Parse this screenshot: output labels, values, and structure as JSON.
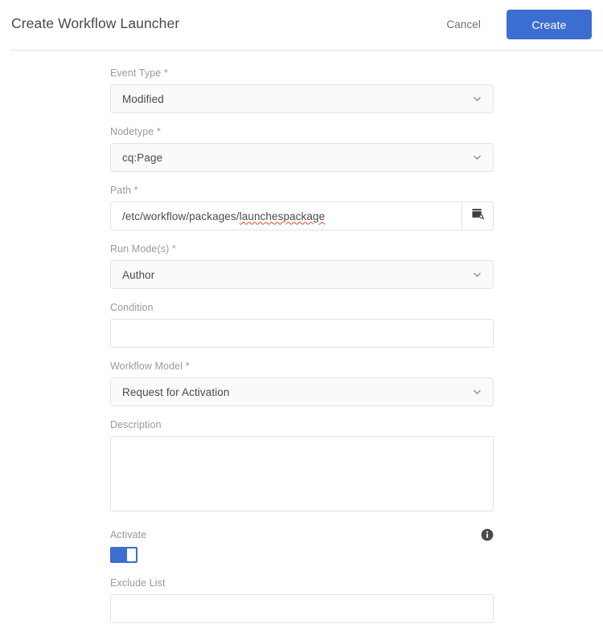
{
  "header": {
    "title": "Create Workflow Launcher",
    "cancel_label": "Cancel",
    "create_label": "Create",
    "accent_color": "#3c6dd0"
  },
  "form": {
    "event_type": {
      "label": "Event Type *",
      "value": "Modified",
      "icon": "chevron-down-icon"
    },
    "nodetype": {
      "label": "Nodetype *",
      "value": "cq:Page",
      "icon": "chevron-down-icon"
    },
    "path": {
      "label": "Path *",
      "value_prefix": "/etc/workflow/packages/",
      "value_misspelled": "launchespackage",
      "value": "/etc/workflow/packages/launchespackage",
      "placeholder": "",
      "browse_icon": "folder-search-icon"
    },
    "run_modes": {
      "label": "Run Mode(s) *",
      "value": "Author",
      "icon": "chevron-down-icon"
    },
    "condition": {
      "label": "Condition",
      "value": "",
      "placeholder": ""
    },
    "workflow_model": {
      "label": "Workflow Model *",
      "value": "Request for Activation",
      "icon": "chevron-down-icon"
    },
    "description": {
      "label": "Description",
      "value": "",
      "placeholder": ""
    },
    "activate": {
      "label": "Activate",
      "state": "on",
      "info_icon": "info-icon",
      "toggle_color": "#3c6dd0"
    },
    "exclude_list": {
      "label": "Exclude List",
      "value": "",
      "placeholder": ""
    }
  }
}
